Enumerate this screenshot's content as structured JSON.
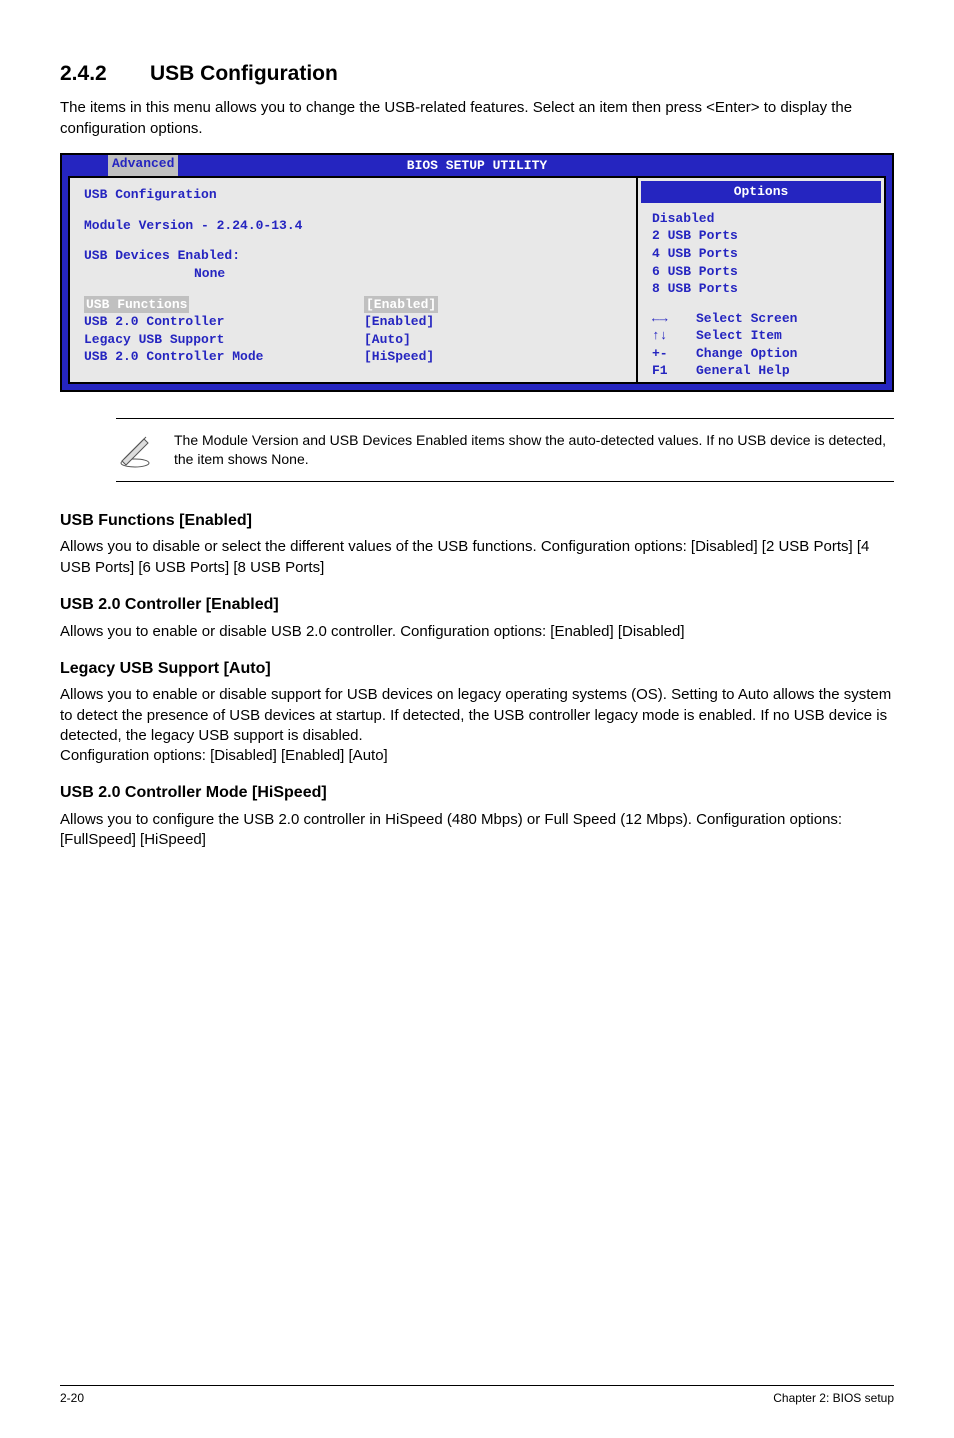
{
  "heading": {
    "number": "2.4.2",
    "title": "USB Configuration"
  },
  "intro": "The items in this menu allows you to change the USB-related features. Select an item then press <Enter> to display the configuration options.",
  "bios": {
    "setup_title": "BIOS SETUP UTILITY",
    "tab": "Advanced",
    "left": {
      "title": "USB Configuration",
      "module_line": "Module Version - 2.24.0-13.4",
      "devices_line": "USB Devices Enabled:",
      "devices_none": "None",
      "rows": [
        {
          "label": "USB Functions",
          "value": "[Enabled]",
          "hl": true
        },
        {
          "label": "USB 2.0 Controller",
          "value": "[Enabled]",
          "hl": false
        },
        {
          "label": "Legacy USB Support",
          "value": "[Auto]",
          "hl": false
        },
        {
          "label": "USB 2.0 Controller Mode",
          "value": "[HiSpeed]",
          "hl": false
        }
      ]
    },
    "right": {
      "title": "Options",
      "options": [
        "Disabled",
        "2 USB Ports",
        "4 USB Ports",
        "6 USB Ports",
        "8 USB Ports"
      ],
      "nav": [
        {
          "key": "←→",
          "label": "Select Screen"
        },
        {
          "key": "↑↓",
          "label": "Select Item"
        },
        {
          "key": "+-",
          "label": "Change Option"
        },
        {
          "key": "F1",
          "label": "General Help"
        }
      ]
    }
  },
  "note": "The Module Version and USB Devices Enabled items show the auto-detected values. If no USB device is detected, the item shows None.",
  "sections": [
    {
      "title": "USB Functions [Enabled]",
      "body": "Allows you to disable or select the different values of the USB functions. Configuration options: [Disabled] [2 USB Ports] [4 USB Ports] [6 USB Ports] [8 USB Ports]"
    },
    {
      "title": "USB 2.0 Controller [Enabled]",
      "body": "Allows you to enable or disable USB 2.0 controller. Configuration options: [Enabled] [Disabled]"
    },
    {
      "title": "Legacy USB Support [Auto]",
      "body": "Allows you to enable or disable support for USB devices on legacy operating systems (OS). Setting to Auto allows the system to detect the presence of USB devices at startup. If detected, the USB controller legacy mode is enabled. If no USB device is detected, the legacy USB support is disabled.\nConfiguration options: [Disabled] [Enabled] [Auto]"
    },
    {
      "title": "USB 2.0 Controller Mode [HiSpeed]",
      "body": "Allows you to configure the USB 2.0 controller in HiSpeed (480 Mbps) or Full Speed (12 Mbps). Configuration options: [FullSpeed] [HiSpeed]"
    }
  ],
  "footer": {
    "left": "2-20",
    "right": "Chapter 2: BIOS setup"
  }
}
